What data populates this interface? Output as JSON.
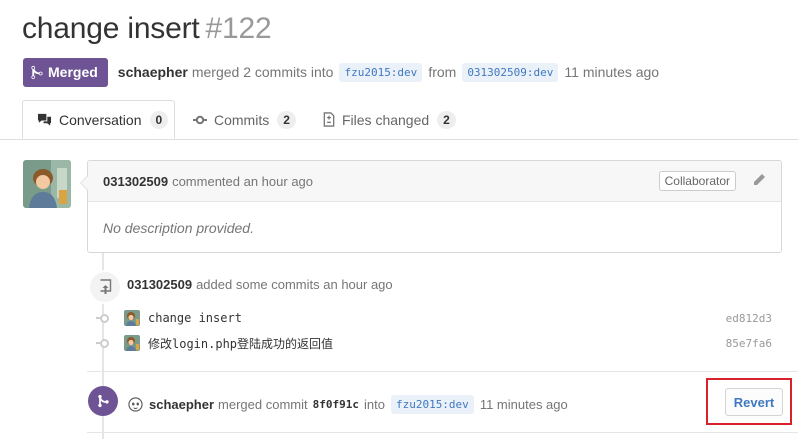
{
  "pr": {
    "title": "change insert",
    "number": "#122",
    "state": "Merged",
    "merger": "schaepher",
    "merge_text": "merged 2 commits into",
    "base_branch": "fzu2015:dev",
    "from_text": "from",
    "head_branch": "031302509:dev",
    "time_ago": "11 minutes ago"
  },
  "tabs": [
    {
      "label": "Conversation",
      "count": "0",
      "icon": "comment-discussion-icon"
    },
    {
      "label": "Commits",
      "count": "2",
      "icon": "git-commit-icon"
    },
    {
      "label": "Files changed",
      "count": "2",
      "icon": "file-diff-icon"
    }
  ],
  "comment": {
    "author": "031302509",
    "action": "commented an hour ago",
    "role": "Collaborator",
    "body": "No description provided."
  },
  "commits_event": {
    "author": "031302509",
    "action": "added some commits an hour ago",
    "commits": [
      {
        "message": "change insert",
        "sha": "ed812d3"
      },
      {
        "message": "修改login.php登陆成功的返回值",
        "sha": "85e7fa6"
      }
    ]
  },
  "merge_event": {
    "author": "schaepher",
    "action": "merged commit",
    "commit": "8f0f91c",
    "into_text": "into",
    "branch": "fzu2015:dev",
    "time_ago": "11 minutes ago",
    "revert_label": "Revert"
  },
  "colors": {
    "merged_purple": "#6e5494",
    "link_blue": "#4078c0",
    "highlight_red": "#d9212b"
  }
}
